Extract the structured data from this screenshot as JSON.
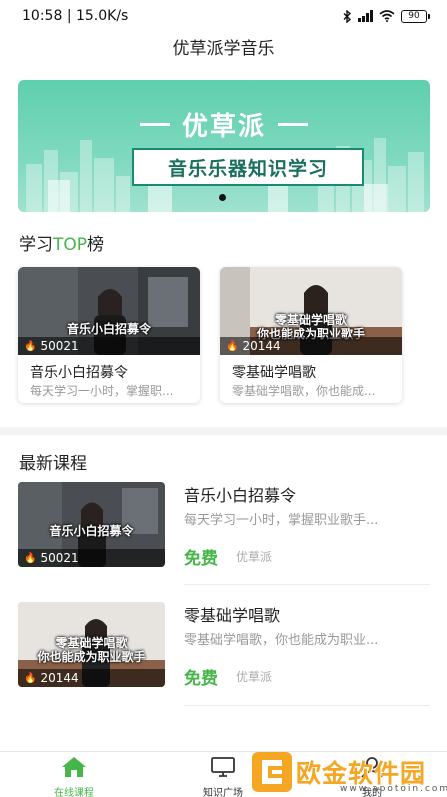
{
  "status_bar": {
    "time": "10:58",
    "network_speed": "15.0K/s",
    "network_type": "4G",
    "battery": "90",
    "icons": [
      "bluetooth-icon",
      "signal-icon",
      "wifi-icon",
      "battery-icon"
    ]
  },
  "header": {
    "title": "优草派学音乐"
  },
  "banner": {
    "brand": "优草派",
    "subtitle": "音乐乐器知识学习",
    "page_count": 1,
    "active_index": 0
  },
  "top_section": {
    "title_prefix": "学习",
    "title_accent": "TOP",
    "title_suffix": "榜"
  },
  "top_courses": [
    {
      "overlay": "音乐小白招募令",
      "views": "50021",
      "title": "音乐小白招募令",
      "desc": "每天学习一小时，掌握职..."
    },
    {
      "overlay_line1": "零基础学唱歌",
      "overlay_line2": "你也能成为职业歌手",
      "views": "20144",
      "title": "零基础学唱歌",
      "desc": "零基础学唱歌，你也能成..."
    }
  ],
  "latest_section": {
    "title": "最新课程"
  },
  "latest_courses": [
    {
      "overlay": "音乐小白招募令",
      "views": "50021",
      "title": "音乐小白招募令",
      "desc": "每天学习一小时，掌握职业歌手...",
      "price": "免费",
      "provider": "优草派"
    },
    {
      "overlay_line1": "零基础学唱歌",
      "overlay_line2": "你也能成为职业歌手",
      "views": "20144",
      "title": "零基础学唱歌",
      "desc": "零基础学唱歌，你也能成为职业...",
      "price": "免费",
      "provider": "优草派"
    }
  ],
  "tabbar": {
    "tabs": [
      {
        "label": "在线课程",
        "icon": "home-icon",
        "active": true
      },
      {
        "label": "知识广场",
        "icon": "monitor-icon",
        "active": false
      },
      {
        "label": "我的",
        "icon": "user-icon",
        "active": false
      }
    ]
  },
  "watermark": {
    "text": "欧金软件园",
    "url": "www.apotoin.com"
  },
  "colors": {
    "accent": "#47b64a",
    "banner": "#5fcfae",
    "watermark": "#f5a623"
  }
}
